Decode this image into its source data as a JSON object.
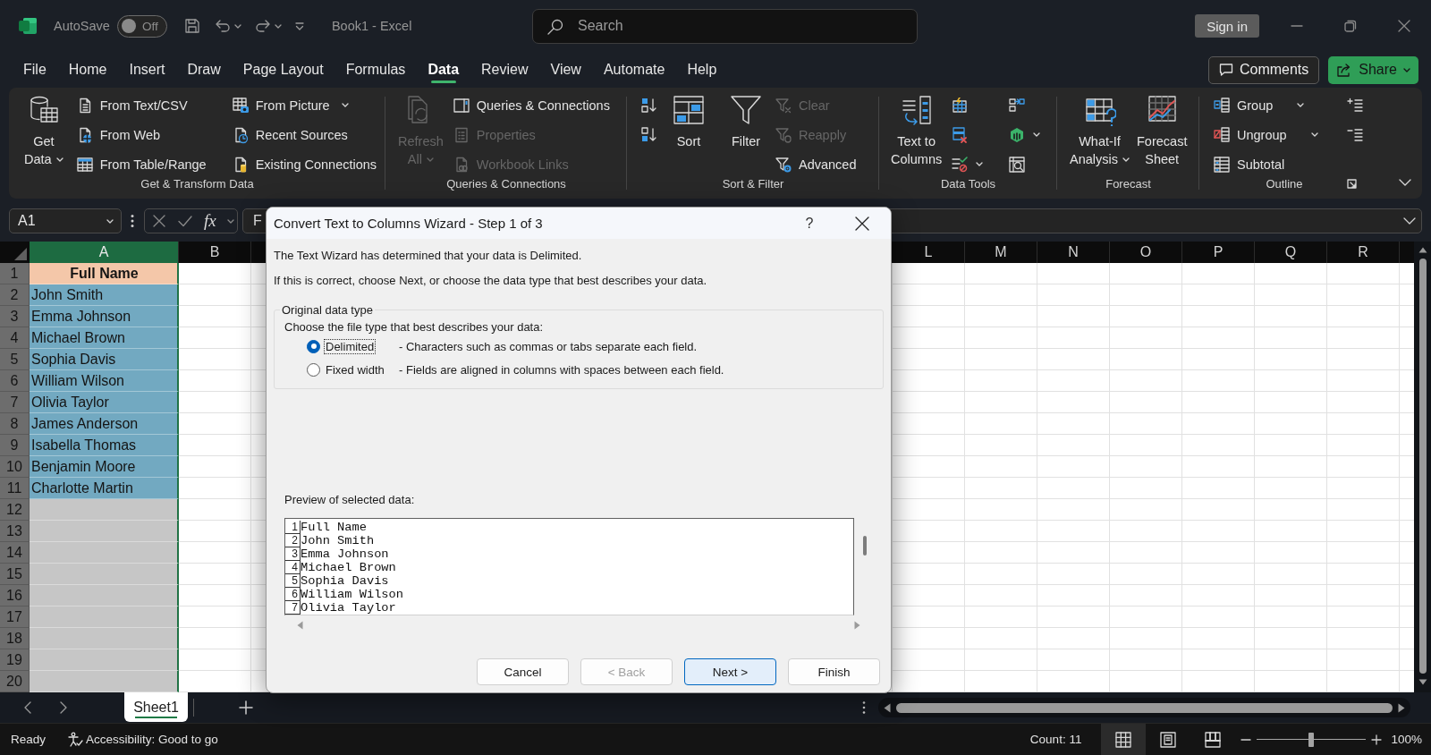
{
  "title_bar": {
    "autosave": {
      "label": "AutoSave",
      "on": false,
      "state_text": "Off"
    },
    "document_title": "Book1 - Excel",
    "search": {
      "placeholder": "Search"
    },
    "sign_in": "Sign in"
  },
  "menu": {
    "tabs": [
      {
        "label": "File",
        "selected": false
      },
      {
        "label": "Home",
        "selected": false
      },
      {
        "label": "Insert",
        "selected": false
      },
      {
        "label": "Draw",
        "selected": false
      },
      {
        "label": "Page Layout",
        "selected": false
      },
      {
        "label": "Formulas",
        "selected": false
      },
      {
        "label": "Data",
        "selected": true
      },
      {
        "label": "Review",
        "selected": false
      },
      {
        "label": "View",
        "selected": false
      },
      {
        "label": "Automate",
        "selected": false
      },
      {
        "label": "Help",
        "selected": false
      }
    ],
    "comments": "Comments",
    "share": "Share"
  },
  "ribbon": {
    "groups": [
      {
        "label": "Get & Transform Data",
        "items": [
          {
            "kind": "large",
            "lines": [
              "Get",
              "Data"
            ],
            "dropdown": true,
            "disabled": false
          },
          {
            "kind": "column",
            "buttons": [
              {
                "label": "From Text/CSV",
                "dropdown": false,
                "disabled": false
              },
              {
                "label": "From Web",
                "dropdown": false,
                "disabled": false
              },
              {
                "label": "From Table/Range",
                "dropdown": false,
                "disabled": false
              }
            ]
          },
          {
            "kind": "column",
            "buttons": [
              {
                "label": "From Picture",
                "dropdown": true,
                "disabled": false
              },
              {
                "label": "Recent Sources",
                "dropdown": false,
                "disabled": false
              },
              {
                "label": "Existing Connections",
                "dropdown": false,
                "disabled": false
              }
            ]
          }
        ]
      },
      {
        "label": "Queries & Connections",
        "items": [
          {
            "kind": "large",
            "lines": [
              "Refresh",
              "All"
            ],
            "dropdown": true,
            "disabled": true
          },
          {
            "kind": "column",
            "buttons": [
              {
                "label": "Queries & Connections",
                "dropdown": false,
                "disabled": false
              },
              {
                "label": "Properties",
                "dropdown": false,
                "disabled": true
              },
              {
                "label": "Workbook Links",
                "dropdown": false,
                "disabled": true
              }
            ]
          }
        ]
      },
      {
        "label": "Sort & Filter",
        "items": [
          {
            "kind": "column",
            "buttons": [
              {
                "dropdown": false,
                "disabled": false
              },
              {
                "dropdown": false,
                "disabled": false
              }
            ]
          },
          {
            "kind": "large",
            "lines": [
              "Sort"
            ],
            "dropdown": false,
            "disabled": false
          },
          {
            "kind": "large",
            "lines": [
              "Filter"
            ],
            "dropdown": false,
            "disabled": false
          },
          {
            "kind": "column",
            "buttons": [
              {
                "label": "Clear",
                "dropdown": false,
                "disabled": true
              },
              {
                "label": "Reapply",
                "dropdown": false,
                "disabled": true
              },
              {
                "label": "Advanced",
                "dropdown": false,
                "disabled": false
              }
            ]
          }
        ]
      },
      {
        "label": "Data Tools",
        "items": [
          {
            "kind": "large",
            "lines": [
              "Text to",
              "Columns"
            ],
            "dropdown": false,
            "disabled": false
          },
          {
            "kind": "column",
            "buttons": [
              {
                "dropdown": false,
                "disabled": false
              },
              {
                "dropdown": false,
                "disabled": false
              },
              {
                "dropdown": true,
                "disabled": false
              }
            ]
          },
          {
            "kind": "column",
            "buttons": [
              {
                "dropdown": false,
                "disabled": false
              },
              {
                "dropdown": true,
                "disabled": false
              },
              {
                "dropdown": false,
                "disabled": false
              }
            ]
          }
        ]
      },
      {
        "label": "Forecast",
        "items": [
          {
            "kind": "large",
            "lines": [
              "What-If",
              "Analysis"
            ],
            "dropdown": true,
            "disabled": false
          },
          {
            "kind": "large",
            "lines": [
              "Forecast",
              "Sheet"
            ],
            "dropdown": false,
            "disabled": false
          }
        ]
      },
      {
        "label": "Outline",
        "items": [
          {
            "kind": "column",
            "buttons": [
              {
                "label": "Group",
                "dropdown": true,
                "disabled": false
              },
              {
                "label": "Ungroup",
                "dropdown": true,
                "disabled": false
              },
              {
                "label": "Subtotal",
                "dropdown": false,
                "disabled": false
              }
            ]
          },
          {
            "kind": "column",
            "buttons": [
              {
                "dropdown": false,
                "disabled": false
              },
              {
                "dropdown": false,
                "disabled": false
              }
            ]
          }
        ]
      }
    ]
  },
  "formula_bar": {
    "name_box": "A1",
    "function_label": "fx",
    "value": "F"
  },
  "sheet": {
    "columns_left": [
      {
        "label": "A",
        "selected": true
      },
      {
        "label": "B",
        "selected": false
      }
    ],
    "columns_right": [
      {
        "label": "L",
        "selected": false
      },
      {
        "label": "M",
        "selected": false
      },
      {
        "label": "N",
        "selected": false
      },
      {
        "label": "O",
        "selected": false
      },
      {
        "label": "P",
        "selected": false
      },
      {
        "label": "Q",
        "selected": false
      },
      {
        "label": "R",
        "selected": false
      }
    ],
    "rows": [
      {
        "number": "1",
        "text": "Full Name",
        "kind": "header",
        "color": "#f4c7a9"
      },
      {
        "number": "2",
        "text": "John Smith",
        "kind": "data",
        "color": "#72a9c1"
      },
      {
        "number": "3",
        "text": "Emma Johnson",
        "kind": "data",
        "color": "#72a9c1"
      },
      {
        "number": "4",
        "text": "Michael Brown",
        "kind": "data",
        "color": "#72a9c1"
      },
      {
        "number": "5",
        "text": "Sophia Davis",
        "kind": "data",
        "color": "#72a9c1"
      },
      {
        "number": "6",
        "text": "William Wilson",
        "kind": "data",
        "color": "#72a9c1"
      },
      {
        "number": "7",
        "text": "Olivia Taylor",
        "kind": "data",
        "color": "#72a9c1"
      },
      {
        "number": "8",
        "text": "James Anderson",
        "kind": "data",
        "color": "#72a9c1"
      },
      {
        "number": "9",
        "text": "Isabella Thomas",
        "kind": "data",
        "color": "#72a9c1"
      },
      {
        "number": "10",
        "text": "Benjamin Moore",
        "kind": "data",
        "color": "#72a9c1"
      },
      {
        "number": "11",
        "text": "Charlotte Martin",
        "kind": "data",
        "color": "#72a9c1"
      },
      {
        "number": "12",
        "kind": "empty"
      },
      {
        "number": "13",
        "kind": "empty"
      },
      {
        "number": "14",
        "kind": "empty"
      },
      {
        "number": "15",
        "kind": "empty"
      },
      {
        "number": "16",
        "kind": "empty"
      },
      {
        "number": "17",
        "kind": "empty"
      },
      {
        "number": "18",
        "kind": "empty"
      },
      {
        "number": "19",
        "kind": "empty"
      },
      {
        "number": "20",
        "kind": "empty"
      }
    ]
  },
  "sheet_tabs": {
    "tabs": [
      {
        "label": "Sheet1",
        "selected": true
      }
    ]
  },
  "status_bar": {
    "mode": "Ready",
    "accessibility": "Accessibility: Good to go",
    "count": "Count: 11",
    "views": [
      {
        "kind": "normal",
        "selected": true
      },
      {
        "kind": "page_layout",
        "selected": false
      },
      {
        "kind": "page_break",
        "selected": false
      }
    ],
    "zoom": {
      "level": 0.5,
      "reading": "100%"
    }
  },
  "dialog": {
    "title": "Convert Text to Columns Wizard - Step 1 of 3",
    "help": "?",
    "intro": [
      "The Text Wizard has determined that your data is Delimited.",
      "If this is correct, choose Next, or choose the data type that best describes your data."
    ],
    "group": {
      "legend": "Original data type",
      "prompt": "Choose the file type that best describes your data:",
      "options": [
        {
          "label": "Delimited",
          "description": "- Characters such as commas or tabs separate each field.",
          "selected": true,
          "focused": true
        },
        {
          "label": "Fixed width",
          "description": "- Fields are aligned in columns with spaces between each field.",
          "selected": false,
          "focused": false
        }
      ]
    },
    "preview": {
      "label": "Preview of selected data:",
      "lines": [
        {
          "number": "1",
          "text": "Full Name"
        },
        {
          "number": "2",
          "text": "John Smith"
        },
        {
          "number": "3",
          "text": "Emma Johnson"
        },
        {
          "number": "4",
          "text": "Michael Brown"
        },
        {
          "number": "5",
          "text": "Sophia Davis"
        },
        {
          "number": "6",
          "text": "William Wilson"
        },
        {
          "number": "7",
          "text": "Olivia Taylor"
        }
      ]
    },
    "buttons": [
      {
        "label": "Cancel",
        "disabled": false,
        "default": false
      },
      {
        "label": "< Back",
        "disabled": true,
        "default": false
      },
      {
        "label": "Next >",
        "disabled": false,
        "default": true
      },
      {
        "label": "Finish",
        "disabled": false,
        "default": false
      }
    ]
  }
}
